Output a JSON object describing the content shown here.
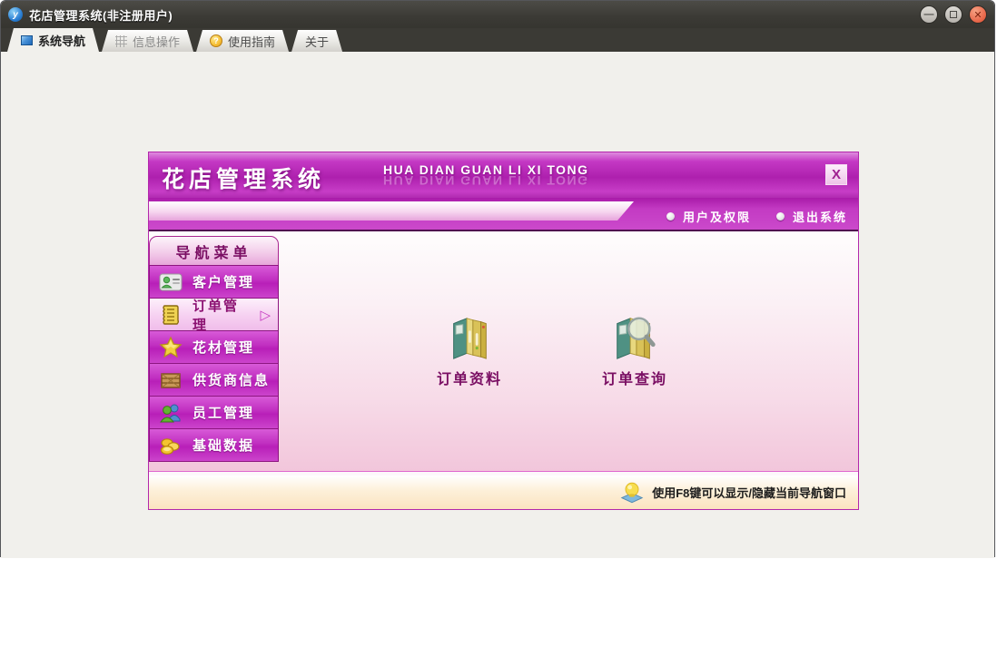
{
  "window": {
    "title": "花店管理系统(非注册用户)",
    "app_icon_letter": "y",
    "controls": {
      "minimize": "—",
      "close": "✕"
    }
  },
  "tabs": [
    {
      "label": "系统导航"
    },
    {
      "label": "信息操作"
    },
    {
      "label": "使用指南"
    },
    {
      "label": "关于"
    }
  ],
  "panel": {
    "title": "花店管理系统",
    "subtitle": "HUA DIAN GUAN LI XI TONG",
    "close_glyph": "X",
    "topmenu": [
      {
        "label": "用户及权限"
      },
      {
        "label": "退出系统"
      }
    ],
    "nav": {
      "header": "导航菜单",
      "items": [
        {
          "label": "客户管理"
        },
        {
          "label": "订单管理"
        },
        {
          "label": "花材管理"
        },
        {
          "label": "供货商信息"
        },
        {
          "label": "员工管理"
        },
        {
          "label": "基础数据"
        }
      ],
      "selected_index": 1,
      "selected_arrow": "▷"
    },
    "shortcuts": [
      {
        "label": "订单资料"
      },
      {
        "label": "订单查询"
      }
    ],
    "statusbar": {
      "text": "使用F8键可以显示/隐藏当前导航窗口"
    }
  },
  "colors": {
    "accent_magenta": "#c238c2",
    "selected_pink": "#f6d0f1",
    "text_magenta": "#7a0e63",
    "close_button_orange": "#e8674a",
    "statusbar_cream": "#fbe3c0"
  }
}
